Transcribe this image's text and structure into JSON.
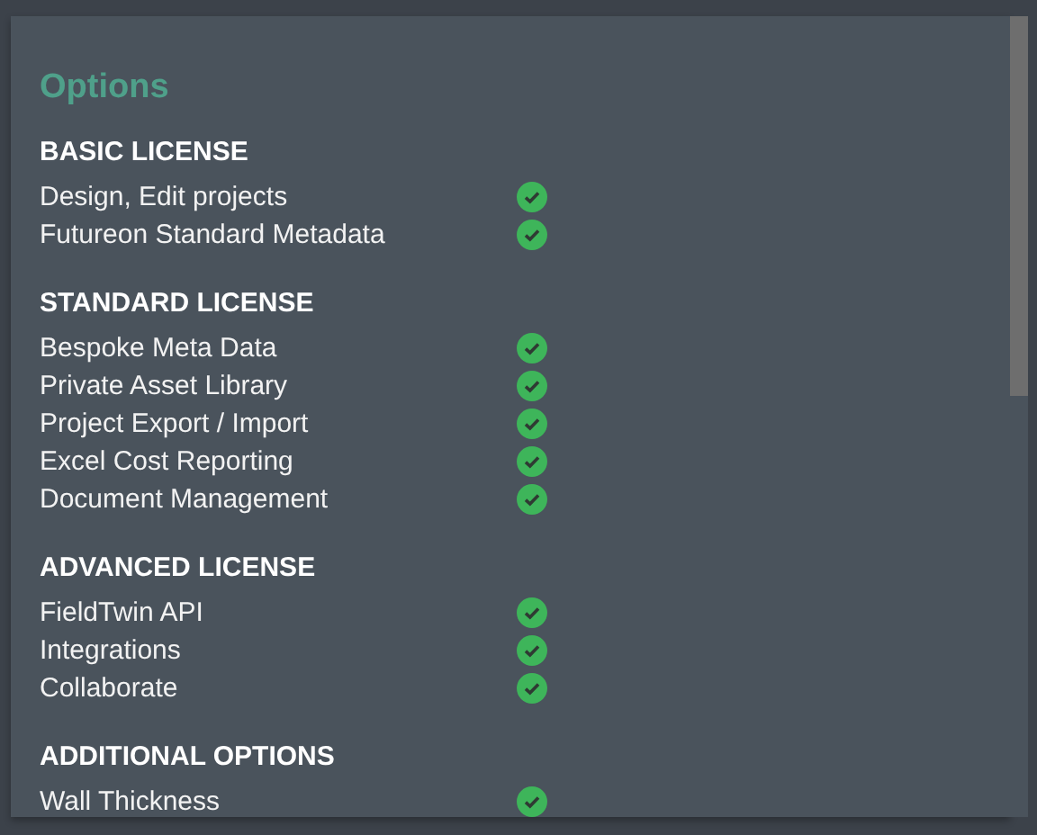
{
  "title": "Options",
  "sections": [
    {
      "heading": "BASIC LICENSE",
      "items": [
        {
          "label": "Design, Edit projects",
          "included": true
        },
        {
          "label": "Futureon Standard Metadata",
          "included": true
        }
      ]
    },
    {
      "heading": "STANDARD LICENSE",
      "items": [
        {
          "label": "Bespoke Meta Data",
          "included": true
        },
        {
          "label": "Private Asset Library",
          "included": true
        },
        {
          "label": "Project Export / Import",
          "included": true
        },
        {
          "label": "Excel Cost Reporting",
          "included": true
        },
        {
          "label": "Document Management",
          "included": true
        }
      ]
    },
    {
      "heading": "ADVANCED LICENSE",
      "items": [
        {
          "label": "FieldTwin API",
          "included": true
        },
        {
          "label": "Integrations",
          "included": true
        },
        {
          "label": "Collaborate",
          "included": true
        }
      ]
    },
    {
      "heading": "ADDITIONAL OPTIONS",
      "items": [
        {
          "label": "Wall Thickness",
          "included": true
        }
      ]
    }
  ]
}
